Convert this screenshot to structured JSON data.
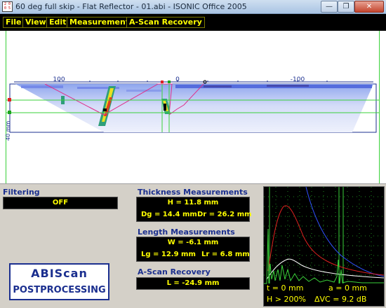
{
  "window": {
    "title": "60 deg full skip - Flat Reflector - 01.abi - ISONIC Office 2005",
    "icon_text": "2 0 0 5",
    "minimize_glyph": "—",
    "maximize_glyph": "❐",
    "close_glyph": "✕"
  },
  "menu": [
    {
      "label": "File"
    },
    {
      "label": "View"
    },
    {
      "label": "Edit"
    },
    {
      "label": "Measurements"
    },
    {
      "label": "A-Scan Recovery"
    }
  ],
  "bscan": {
    "ruler_labels": [
      "100",
      "0",
      "-100"
    ],
    "depth_label": "40 mm",
    "colors": {
      "ruler": "#1b2f8f",
      "beam_path": "#e0308a",
      "gate": "#3ad13a"
    }
  },
  "filtering": {
    "label": "Filtering",
    "value": "OFF"
  },
  "thickness": {
    "label": "Thickness Measurements",
    "h": "H = 11.8 mm",
    "dg": "Dg = 14.4 mm",
    "dr": "Dr = 26.2 mm"
  },
  "length": {
    "label": "Length Measurements",
    "w": "W = -6.1 mm",
    "lg": "Lg = 12.9 mm",
    "lr": "Lr = 6.8 mm"
  },
  "ascan_recovery": {
    "label": "A-Scan Recovery",
    "l": "L = -24.9 mm"
  },
  "logo": {
    "line1": "ABIScan",
    "line2": "POSTPROCESSING"
  },
  "ascan": {
    "t": "t = 0 mm",
    "a": "a = 0 mm",
    "h": "H > 200%",
    "avc": "ΔVC = 9.2 dB",
    "colors": {
      "grid": "#1f8a1f",
      "signal": "#3ad13a",
      "dac_red": "#e02020",
      "dac_blue": "#3050ff",
      "env_white": "#ffffff",
      "text": "#ffff00"
    }
  }
}
